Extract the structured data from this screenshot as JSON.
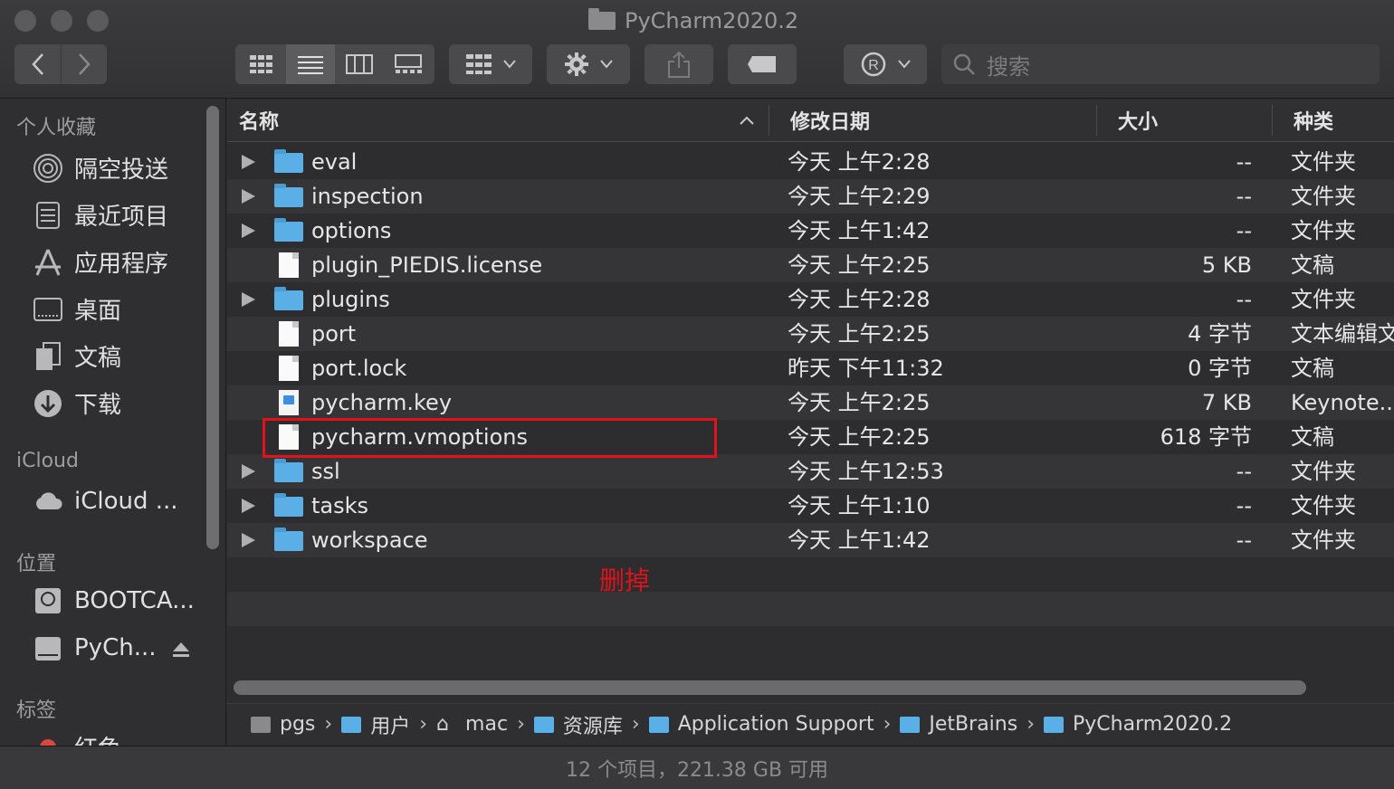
{
  "window": {
    "title": "PyCharm2020.2"
  },
  "toolbar": {
    "back_icon": "chevron-left-icon",
    "forward_icon": "chevron-right-icon",
    "search_placeholder": "搜索"
  },
  "sidebar": {
    "favorites_heading": "个人收藏",
    "favorites": [
      {
        "label": "隔空投送",
        "icon": "airdrop-icon"
      },
      {
        "label": "最近项目",
        "icon": "recents-icon"
      },
      {
        "label": "应用程序",
        "icon": "applications-icon"
      },
      {
        "label": "桌面",
        "icon": "desktop-icon"
      },
      {
        "label": "文稿",
        "icon": "documents-icon"
      },
      {
        "label": "下载",
        "icon": "downloads-icon"
      }
    ],
    "icloud_heading": "iCloud",
    "icloud": [
      {
        "label": "iCloud ...",
        "icon": "cloud-icon"
      }
    ],
    "locations_heading": "位置",
    "locations": [
      {
        "label": "BOOTCA...",
        "icon": "disk-icon"
      },
      {
        "label": "PyCh...",
        "icon": "disk-icon"
      }
    ],
    "tags_heading": "标签",
    "tags": [
      {
        "label": "红色",
        "color": "#e0443e"
      }
    ]
  },
  "columns": {
    "name": "名称",
    "date": "修改日期",
    "size": "大小",
    "kind": "种类"
  },
  "files": [
    {
      "name": "eval",
      "date": "今天 上午2:28",
      "size": "--",
      "kind": "文件夹",
      "type": "folder"
    },
    {
      "name": "inspection",
      "date": "今天 上午2:29",
      "size": "--",
      "kind": "文件夹",
      "type": "folder"
    },
    {
      "name": "options",
      "date": "今天 上午1:42",
      "size": "--",
      "kind": "文件夹",
      "type": "folder"
    },
    {
      "name": "plugin_PIEDIS.license",
      "date": "今天 上午2:25",
      "size": "5 KB",
      "kind": "文稿",
      "type": "doc"
    },
    {
      "name": "plugins",
      "date": "今天 上午2:28",
      "size": "--",
      "kind": "文件夹",
      "type": "folder"
    },
    {
      "name": "port",
      "date": "今天 上午2:25",
      "size": "4 字节",
      "kind": "文本编辑文",
      "type": "doc"
    },
    {
      "name": "port.lock",
      "date": "昨天 下午11:32",
      "size": "0 字节",
      "kind": "文稿",
      "type": "doc"
    },
    {
      "name": "pycharm.key",
      "date": "今天 上午2:25",
      "size": "7 KB",
      "kind": "Keynote...",
      "type": "key"
    },
    {
      "name": "pycharm.vmoptions",
      "date": "今天 上午2:25",
      "size": "618 字节",
      "kind": "文稿",
      "type": "doc"
    },
    {
      "name": "ssl",
      "date": "今天 上午12:53",
      "size": "--",
      "kind": "文件夹",
      "type": "folder"
    },
    {
      "name": "tasks",
      "date": "今天 上午1:10",
      "size": "--",
      "kind": "文件夹",
      "type": "folder"
    },
    {
      "name": "workspace",
      "date": "今天 上午1:42",
      "size": "--",
      "kind": "文件夹",
      "type": "folder"
    }
  ],
  "annotation": {
    "text": "删掉",
    "color": "#e0121a"
  },
  "path": [
    {
      "label": "pgs",
      "icon": "drive-icon"
    },
    {
      "label": "用户",
      "icon": "folder-icon"
    },
    {
      "label": "mac",
      "icon": "home-icon"
    },
    {
      "label": "资源库",
      "icon": "folder-icon"
    },
    {
      "label": "Application Support",
      "icon": "folder-icon"
    },
    {
      "label": "JetBrains",
      "icon": "folder-icon"
    },
    {
      "label": "PyCharm2020.2",
      "icon": "folder-icon"
    }
  ],
  "status": {
    "text": "12 个项目，221.38 GB 可用"
  }
}
